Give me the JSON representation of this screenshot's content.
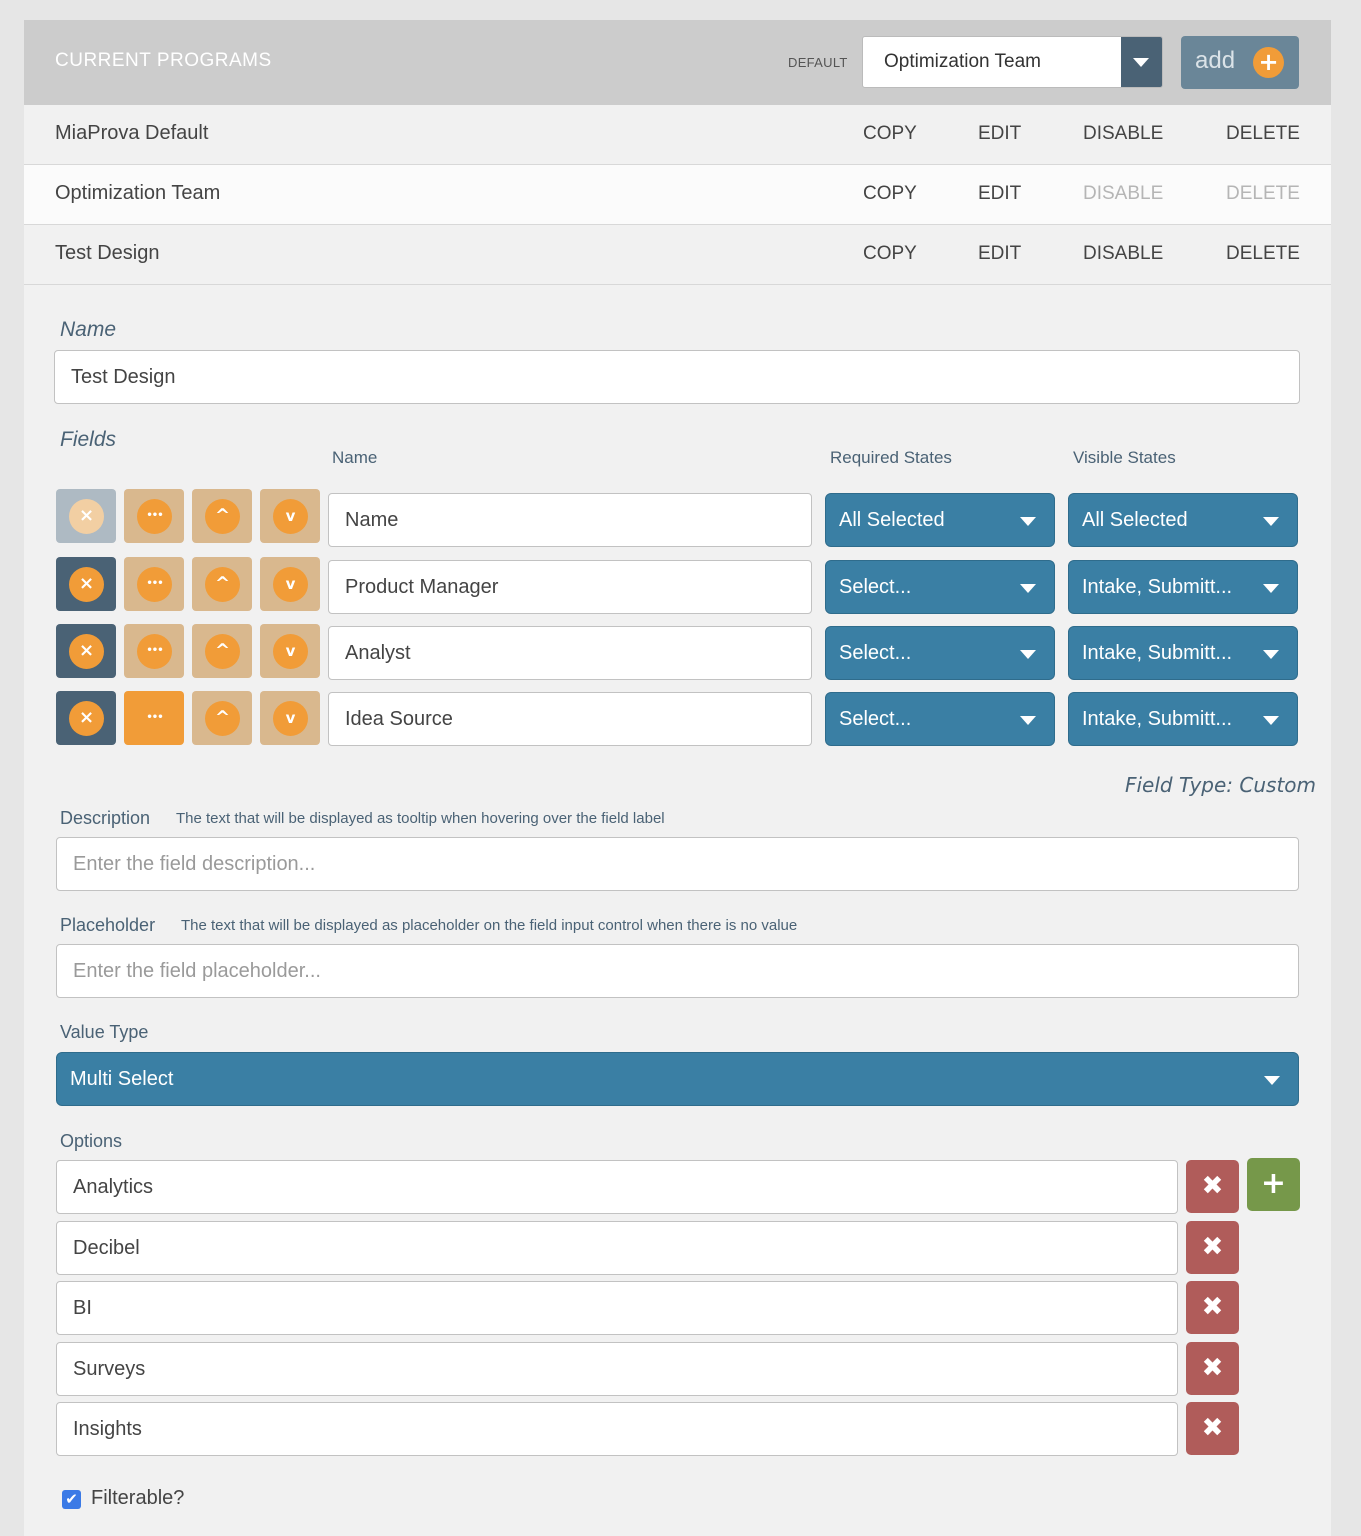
{
  "header": {
    "title": "CURRENT PROGRAMS",
    "default_label": "DEFAULT",
    "default_value": "Optimization Team",
    "add_label": "add",
    "add_icon": "+"
  },
  "programs": [
    {
      "name": "MiaProva Default",
      "copy": "COPY",
      "edit": "EDIT",
      "disable": "DISABLE",
      "delete": "DELETE",
      "disable_enabled": true,
      "delete_enabled": true
    },
    {
      "name": "Optimization Team",
      "copy": "COPY",
      "edit": "EDIT",
      "disable": "DISABLE",
      "delete": "DELETE",
      "disable_enabled": false,
      "delete_enabled": false
    },
    {
      "name": "Test Design",
      "copy": "COPY",
      "edit": "EDIT",
      "disable": "DISABLE",
      "delete": "DELETE",
      "disable_enabled": true,
      "delete_enabled": true
    }
  ],
  "form": {
    "name_label": "Name",
    "name_value": "Test Design",
    "fields_label": "Fields",
    "columns": {
      "name": "Name",
      "required": "Required States",
      "visible": "Visible States"
    },
    "fields": [
      {
        "name": "Name",
        "required": "All Selected",
        "visible": "All Selected"
      },
      {
        "name": "Product Manager",
        "required": "Select...",
        "visible": "Intake, Submitt..."
      },
      {
        "name": "Analyst",
        "required": "Select...",
        "visible": "Intake, Submitt..."
      },
      {
        "name": "Idea Source",
        "required": "Select...",
        "visible": "Intake, Submitt..."
      }
    ],
    "icons": {
      "remove": "×",
      "more": "•••",
      "up": "^",
      "down": "v"
    },
    "field_type": "Field Type: Custom",
    "description": {
      "label": "Description",
      "help": "The text that will be displayed as tooltip when hovering over the field label",
      "placeholder": "Enter the field description..."
    },
    "placeholder": {
      "label": "Placeholder",
      "help": "The text that will be displayed as placeholder on the field input control when there is no value",
      "placeholder": "Enter the field placeholder..."
    },
    "value_type": {
      "label": "Value Type",
      "value": "Multi Select"
    },
    "options": {
      "label": "Options",
      "items": [
        "Analytics",
        "Decibel",
        "BI",
        "Surveys",
        "Insights"
      ],
      "delete_icon": "✖",
      "add_icon": "+"
    },
    "filterable": {
      "label": "Filterable?",
      "checked": true,
      "check_icon": "✔"
    }
  },
  "colors": {
    "header_bg": "#cccccc",
    "select_blue": "#3a7fa4",
    "dark_slate": "#4a6275",
    "orange": "#f19c38",
    "tan": "#d9b88e",
    "delete_red": "#b05c5a",
    "add_green": "#76984a",
    "checkbox_blue": "#3b7ae6"
  }
}
